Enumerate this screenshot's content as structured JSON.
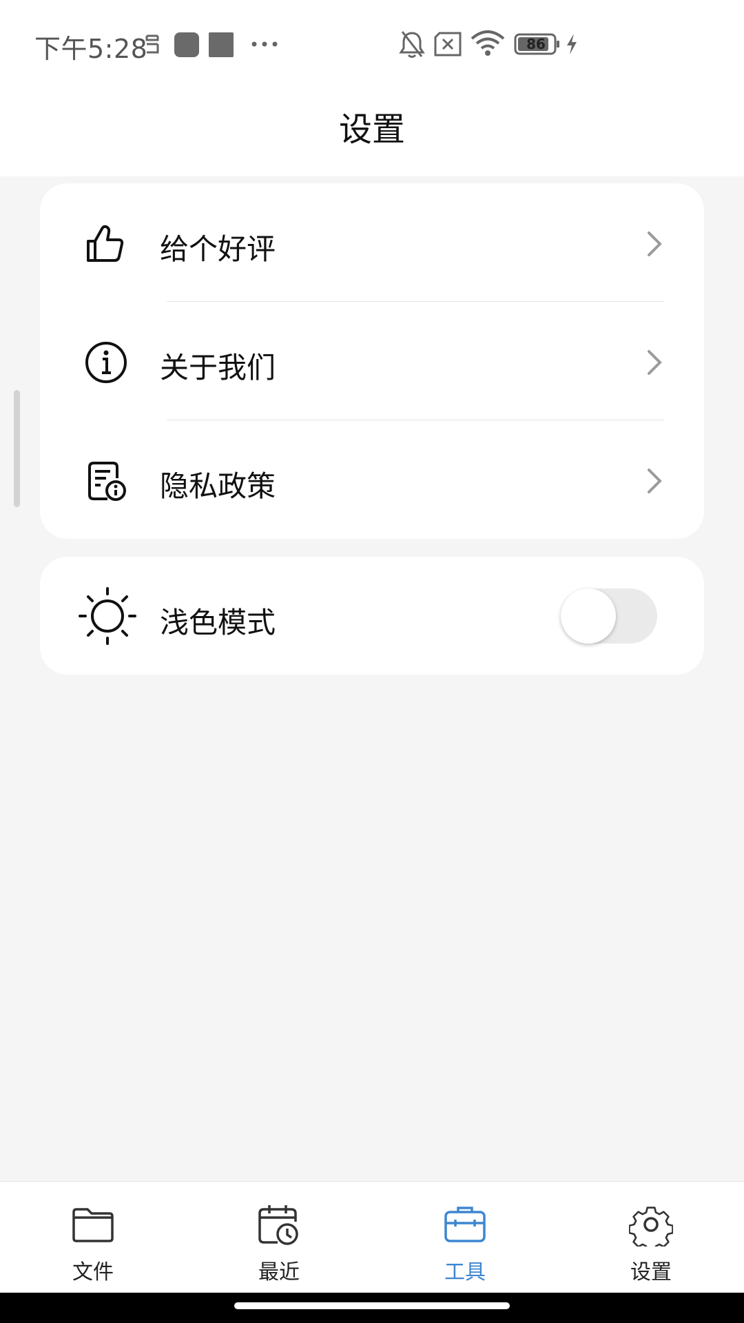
{
  "status_bar": {
    "time": "下午5:28",
    "battery": "86",
    "icons": [
      "sim-icon",
      "app-square-icon",
      "app-square-icon",
      "more-dots-icon",
      "mute-bell-icon",
      "no-sim-icon",
      "wifi-icon",
      "battery-icon",
      "charging-icon"
    ]
  },
  "header": {
    "title": "设置"
  },
  "settings": {
    "items": [
      {
        "label": "给个好评",
        "icon": "thumbs-up-icon"
      },
      {
        "label": "关于我们",
        "icon": "info-icon"
      },
      {
        "label": "隐私政策",
        "icon": "privacy-document-icon"
      }
    ],
    "light_mode": {
      "label": "浅色模式",
      "icon": "sun-icon",
      "enabled": false
    }
  },
  "bottom_nav": {
    "items": [
      {
        "label": "文件",
        "icon": "folder-icon"
      },
      {
        "label": "最近",
        "icon": "calendar-clock-icon"
      },
      {
        "label": "工具",
        "icon": "toolbox-icon",
        "active": true
      },
      {
        "label": "设置",
        "icon": "gear-icon"
      }
    ],
    "active_color": "#3d86d1"
  }
}
